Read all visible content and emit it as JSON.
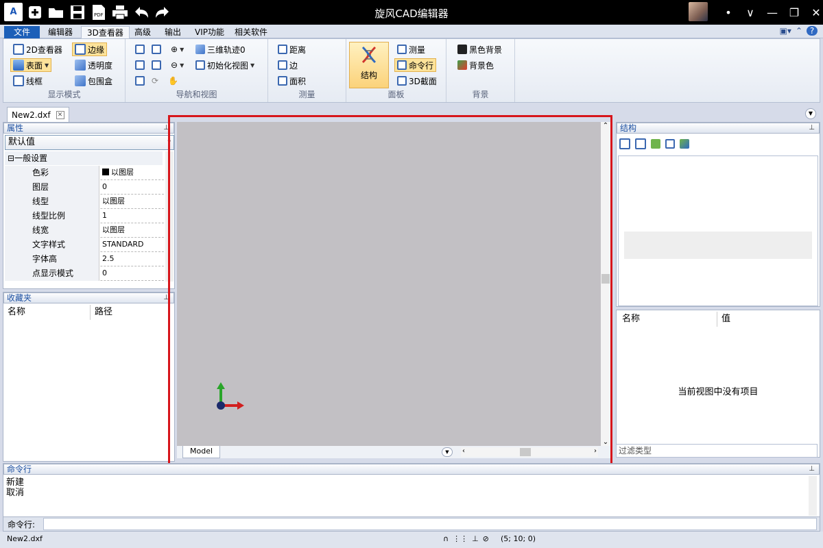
{
  "app": {
    "title": "旋风CAD编辑器"
  },
  "ribbon_tabs": [
    "文件",
    "编辑器",
    "3D查看器",
    "高级",
    "输出",
    "VIP功能",
    "相关软件"
  ],
  "groups": {
    "display": {
      "label": "显示模式",
      "btn_2d": "2D查看器",
      "btn_edge": "边缘",
      "btn_surface": "表面",
      "btn_transparency": "透明度",
      "btn_wireframe": "线框",
      "btn_bbox": "包围盒"
    },
    "nav": {
      "label": "导航和视图",
      "btn_orbit": "三维轨迹0",
      "btn_initview": "初始化视图"
    },
    "measure": {
      "label": "测量",
      "btn_distance": "距离",
      "btn_edge": "边",
      "btn_area": "面积"
    },
    "panel": {
      "label": "面板",
      "btn_structure": "结构",
      "btn_measure": "测量",
      "btn_cmdline": "命令行",
      "btn_section": "3D截面"
    },
    "background": {
      "label": "背景",
      "btn_black": "黑色背景",
      "btn_color": "背景色"
    }
  },
  "document": {
    "tab": "New2.dxf"
  },
  "properties": {
    "title": "属性",
    "combo": "默认值",
    "category": "一般设置",
    "rows": [
      {
        "key": "色彩",
        "value": "以图层"
      },
      {
        "key": "图层",
        "value": "0"
      },
      {
        "key": "线型",
        "value": "以图层"
      },
      {
        "key": "线型比例",
        "value": "1"
      },
      {
        "key": "线宽",
        "value": "以图层"
      },
      {
        "key": "文字样式",
        "value": "STANDARD"
      },
      {
        "key": "字体高",
        "value": "2.5"
      },
      {
        "key": "点显示模式",
        "value": "0"
      }
    ]
  },
  "favorites": {
    "title": "收藏夹",
    "col_name": "名称",
    "col_path": "路径"
  },
  "viewport": {
    "model_tab": "Model"
  },
  "structure": {
    "title": "结构"
  },
  "values": {
    "col_name": "名称",
    "col_value": "值",
    "empty": "当前视图中没有项目",
    "filter": "过滤类型"
  },
  "command": {
    "title": "命令行",
    "history": [
      "新建",
      "取消"
    ],
    "prompt": "命令行:"
  },
  "status": {
    "file": "New2.dxf",
    "coords": "(5; 10; 0)"
  }
}
